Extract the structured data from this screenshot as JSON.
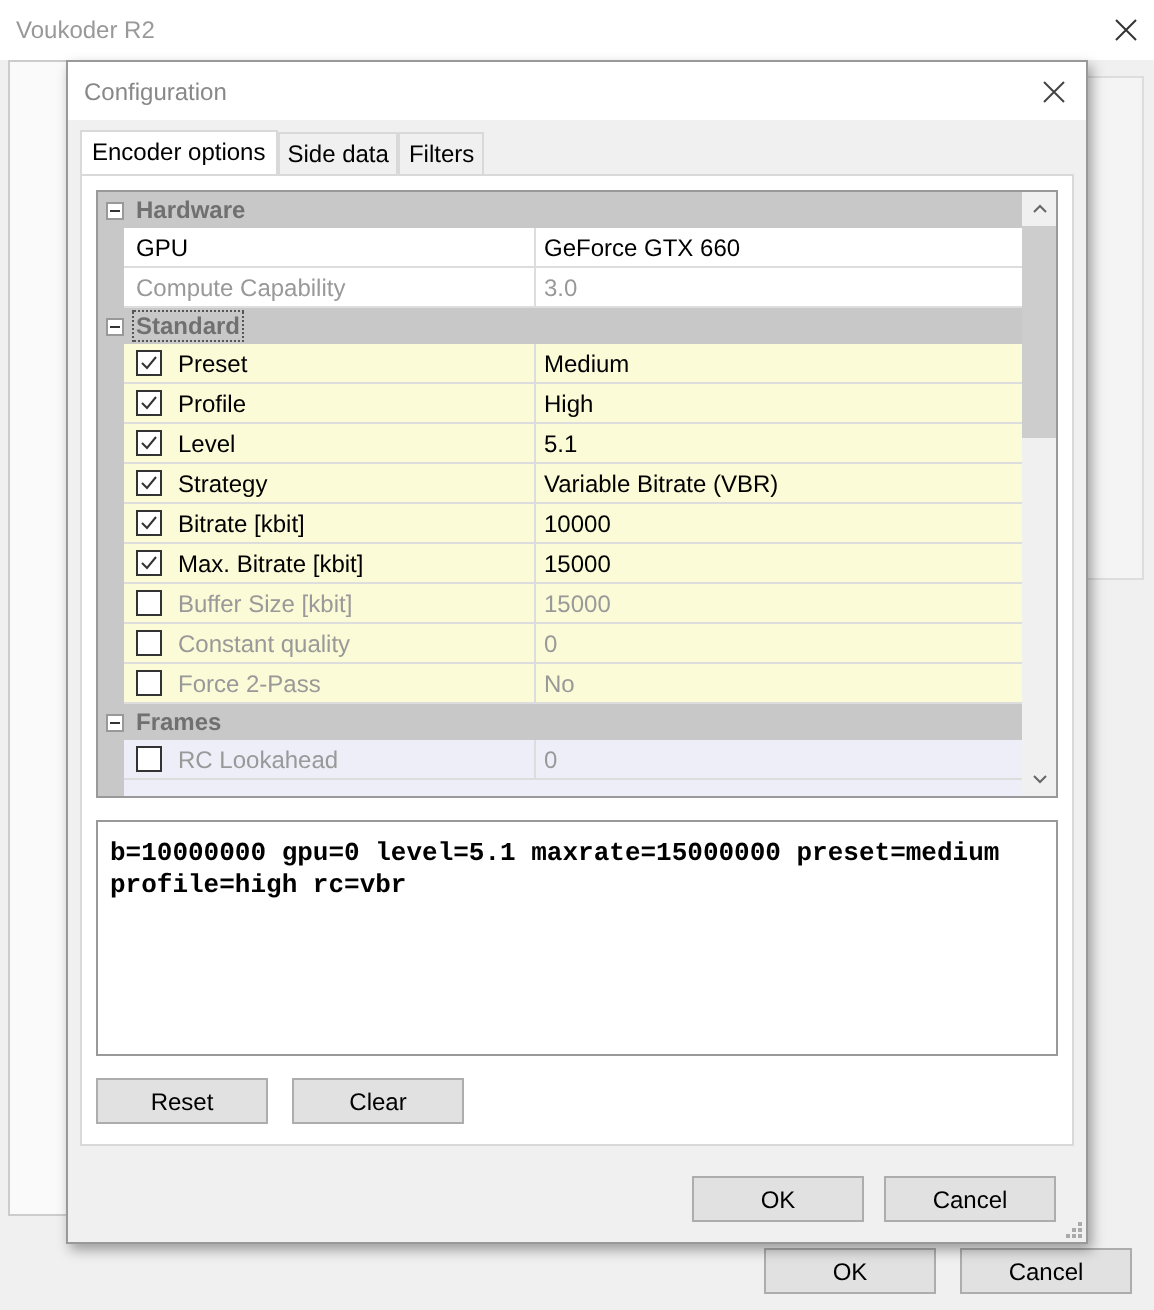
{
  "main_window": {
    "title": "Voukoder R2",
    "buttons": [
      "OK",
      "Cancel"
    ]
  },
  "dialog": {
    "title": "Configuration",
    "tabs": [
      {
        "label": "Encoder options",
        "selected": true
      },
      {
        "label": "Side data",
        "selected": false
      },
      {
        "label": "Filters",
        "selected": false
      }
    ],
    "property_grid": {
      "categories": [
        {
          "name": "Hardware",
          "expanded": true,
          "selected": false,
          "color": "#ffffff",
          "items": [
            {
              "kind": "plain",
              "label": "GPU",
              "value": "GeForce GTX 660",
              "disabled": false
            },
            {
              "kind": "plain",
              "label": "Compute Capability",
              "value": "3.0",
              "disabled": true
            }
          ]
        },
        {
          "name": "Standard",
          "expanded": true,
          "selected": true,
          "color": "#fbfbd7",
          "items": [
            {
              "kind": "checkbox",
              "label": "Preset",
              "value": "Medium",
              "checked": true,
              "disabled": false
            },
            {
              "kind": "checkbox",
              "label": "Profile",
              "value": "High",
              "checked": true,
              "disabled": false
            },
            {
              "kind": "checkbox",
              "label": "Level",
              "value": "5.1",
              "checked": true,
              "disabled": false
            },
            {
              "kind": "checkbox",
              "label": "Strategy",
              "value": "Variable Bitrate (VBR)",
              "checked": true,
              "disabled": false
            },
            {
              "kind": "checkbox",
              "label": "Bitrate [kbit]",
              "value": "10000",
              "checked": true,
              "disabled": false
            },
            {
              "kind": "checkbox",
              "label": "Max. Bitrate [kbit]",
              "value": "15000",
              "checked": true,
              "disabled": false
            },
            {
              "kind": "checkbox",
              "label": "Buffer Size [kbit]",
              "value": "15000",
              "checked": false,
              "disabled": true
            },
            {
              "kind": "checkbox",
              "label": "Constant quality",
              "value": "0",
              "checked": false,
              "disabled": true
            },
            {
              "kind": "checkbox",
              "label": "Force 2-Pass",
              "value": "No",
              "checked": false,
              "disabled": true
            }
          ]
        },
        {
          "name": "Frames",
          "expanded": true,
          "selected": false,
          "color": "#eeeef9",
          "items": [
            {
              "kind": "checkbox",
              "label": "RC Lookahead",
              "value": "0",
              "checked": false,
              "disabled": true
            }
          ]
        }
      ]
    },
    "options_text": "b=10000000 gpu=0 level=5.1 maxrate=15000000 preset=medium profile=high rc=vbr",
    "panel_buttons": [
      "Reset",
      "Clear"
    ],
    "buttons": [
      "OK",
      "Cancel"
    ]
  }
}
